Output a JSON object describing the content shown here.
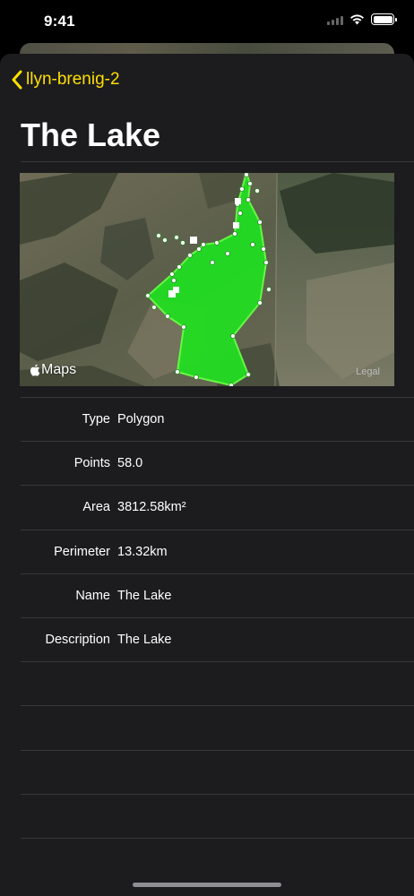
{
  "status": {
    "time": "9:41"
  },
  "nav": {
    "back_label": "llyn-brenig-2"
  },
  "page": {
    "title": "The Lake"
  },
  "map": {
    "logo_text": "Maps",
    "legal_text": "Legal"
  },
  "details": [
    {
      "key": "Type",
      "value": "Polygon"
    },
    {
      "key": "Points",
      "value": "58.0"
    },
    {
      "key": "Area",
      "value": "3812.58km²"
    },
    {
      "key": "Perimeter",
      "value": "13.32km"
    },
    {
      "key": "Name",
      "value": "The Lake"
    },
    {
      "key": "Description",
      "value": "The Lake"
    }
  ],
  "colors": {
    "accent": "#ffdf00",
    "polygon": "#22dd22",
    "background": "#1c1c1e"
  }
}
